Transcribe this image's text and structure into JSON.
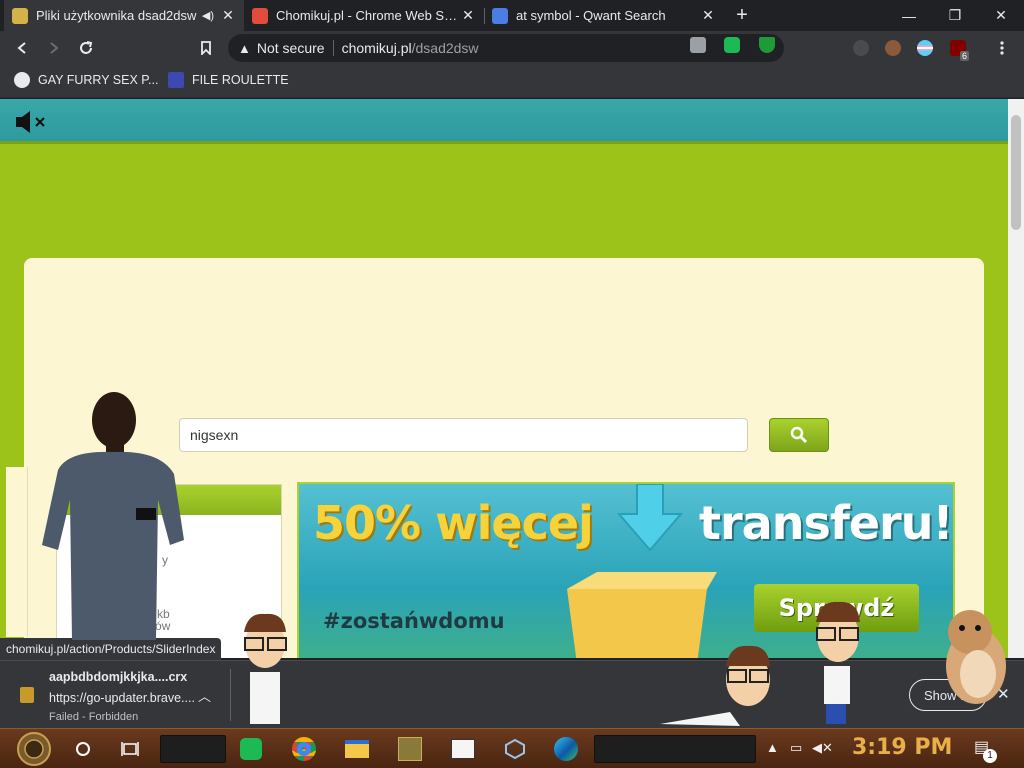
{
  "tabs": [
    {
      "title": "Pliki użytkownika dsad2dsw",
      "favicon_color": "#d4b24a",
      "audio": true
    },
    {
      "title": "Chomikuj.pl - Chrome Web Store",
      "favicon_color": "#e14d3a"
    },
    {
      "title": "at symbol - Qwant Search",
      "favicon_color": "#4a7ee0"
    }
  ],
  "new_tab": "+",
  "window": {
    "minimize": "—",
    "restore": "❐",
    "close": "✕"
  },
  "toolbar": {
    "security_label": "Not secure",
    "url_host": "chomikuj.pl",
    "url_path": "/dsad2dsw",
    "ublock_count": "6"
  },
  "bookmarks": [
    {
      "label": "GAY FURRY SEX P...",
      "icon": "globe-icon"
    },
    {
      "label": "FILE ROULETTE",
      "icon": "mft-icon"
    }
  ],
  "page": {
    "search_value": "nigsexn",
    "side_text_1": "y",
    "side_text_2": "0 kb",
    "side_text_3": "0 plików",
    "banner": {
      "headline_left": "50% więcej",
      "headline_right": "transferu!",
      "tagline": "#zostańwdomu",
      "cta": "Sprawdź"
    },
    "colors": {
      "page_bg": "#9bc31a",
      "header_bg": "#2c9aa0",
      "card_bg": "#fdf6d3",
      "accent": "#8bb31e"
    }
  },
  "status_url": "chomikuj.pl/action/Products/SliderIndex",
  "download": {
    "filename": "aapbdbdomjkkjka....crx",
    "url": "https://go-updater.brave....",
    "status": "Failed - Forbidden",
    "show_all": "Show all"
  },
  "taskbar": {
    "clock": "3:19 PM",
    "notification_count": "1"
  }
}
